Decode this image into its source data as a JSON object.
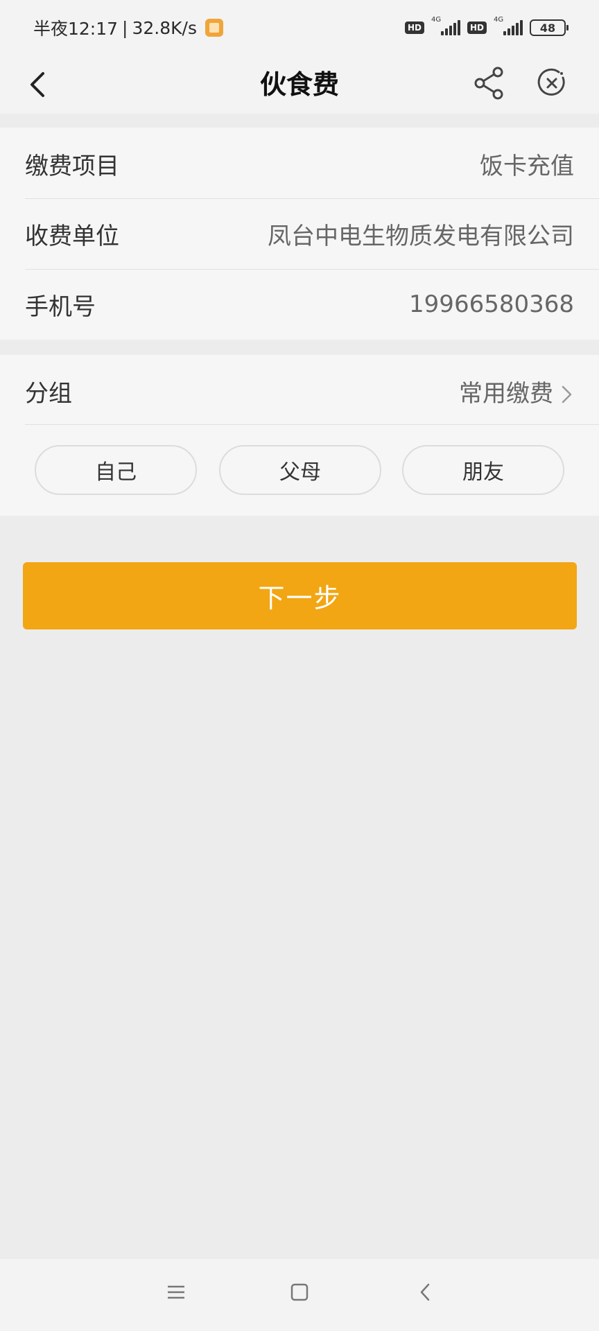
{
  "status_bar": {
    "time": "半夜12:17",
    "network_speed": "32.8K/s",
    "hd_label": "HD",
    "net_type": "4G",
    "battery": "48"
  },
  "nav": {
    "title": "伙食费"
  },
  "details": {
    "rows": [
      {
        "label": "缴费项目",
        "value": "饭卡充值"
      },
      {
        "label": "收费单位",
        "value": "凤台中电生物质发电有限公司"
      },
      {
        "label": "手机号",
        "value": "19966580368"
      }
    ]
  },
  "group": {
    "label": "分组",
    "value": "常用缴费",
    "chips": [
      "自己",
      "父母",
      "朋友"
    ]
  },
  "next_button": "下一步",
  "colors": {
    "accent": "#f2a613",
    "background": "#ececec",
    "card": "#f6f6f6"
  }
}
